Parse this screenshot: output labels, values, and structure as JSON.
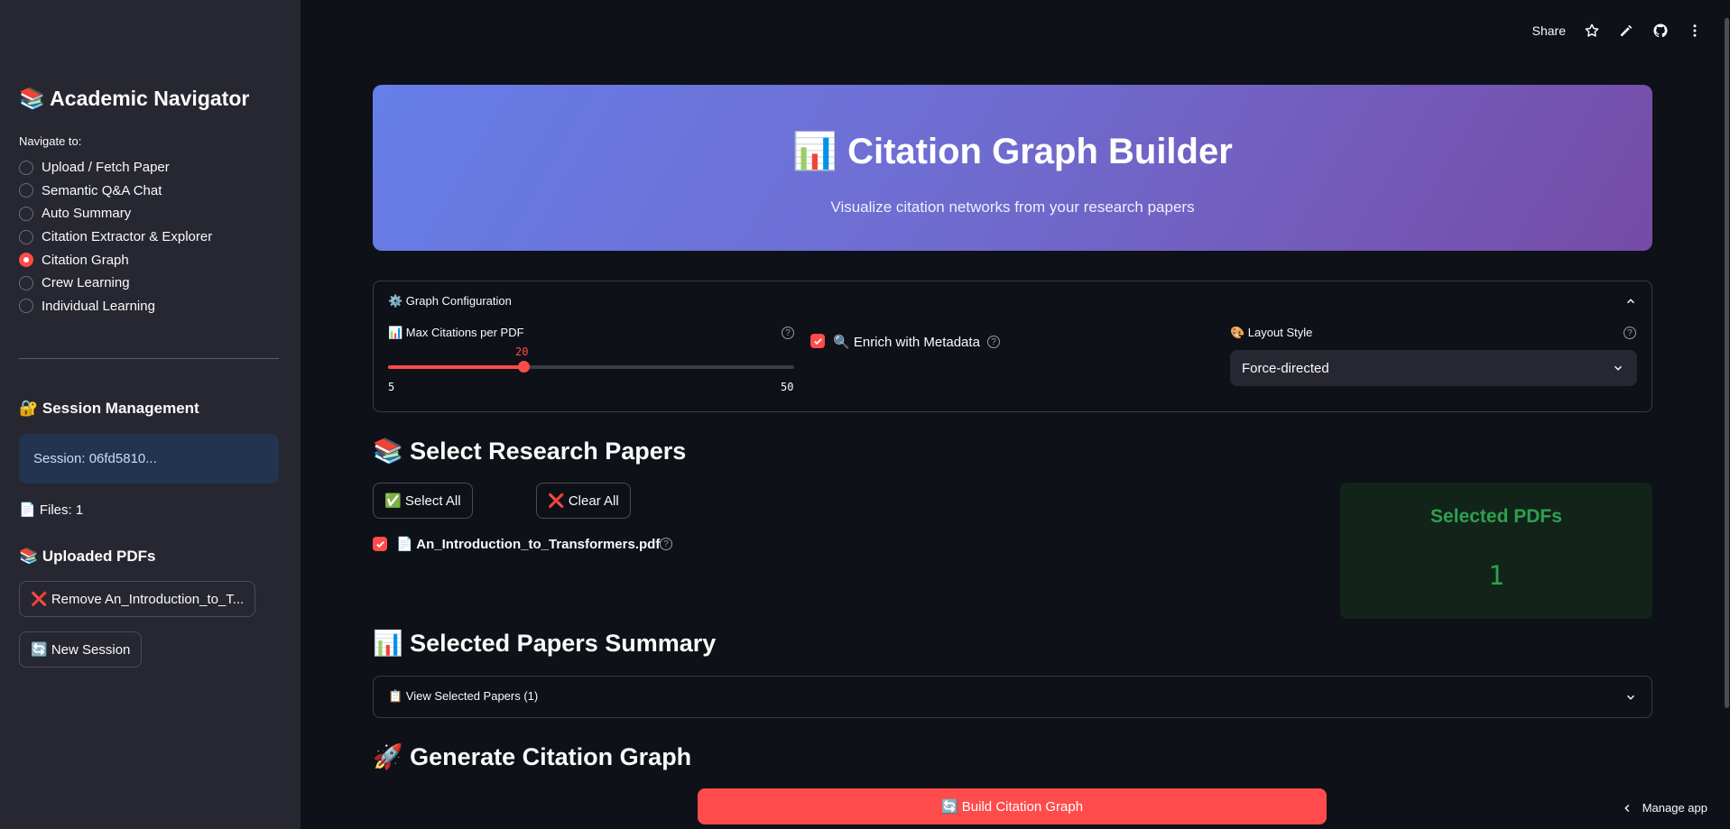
{
  "sidebar": {
    "app_title": "📚 Academic Navigator",
    "nav_label": "Navigate to:",
    "nav_items": [
      {
        "label": "Upload / Fetch Paper",
        "selected": false
      },
      {
        "label": "Semantic Q&A Chat",
        "selected": false
      },
      {
        "label": "Auto Summary",
        "selected": false
      },
      {
        "label": "Citation Extractor & Explorer",
        "selected": false
      },
      {
        "label": "Citation Graph",
        "selected": true
      },
      {
        "label": "Crew Learning",
        "selected": false
      },
      {
        "label": "Individual Learning",
        "selected": false
      }
    ],
    "session_heading": "🔐 Session Management",
    "session_text": "Session: 06fd5810...",
    "files_text": "📄 Files: 1",
    "uploaded_heading": "📚 Uploaded PDFs",
    "remove_button": "❌ Remove An_Introduction_to_T...",
    "new_session_button": "🔄 New Session"
  },
  "toolbar": {
    "share_label": "Share",
    "icons": [
      "star-icon",
      "edit-icon",
      "github-icon",
      "more-vertical-icon"
    ]
  },
  "hero": {
    "title": "📊 Citation Graph Builder",
    "subtitle": "Visualize citation networks from your research papers",
    "gradient": [
      "#667ee8",
      "#764ba7"
    ]
  },
  "config": {
    "header": "⚙️ Graph Configuration",
    "max_citations_label": "📊 Max Citations per PDF",
    "slider_value": "20",
    "slider_min": "5",
    "slider_max": "50",
    "enrich_label": "🔍 Enrich with Metadata",
    "enrich_checked": true,
    "layout_label": "🎨 Layout Style",
    "layout_value": "Force-directed"
  },
  "select_papers": {
    "heading": "📚 Select Research Papers",
    "select_all": "✅ Select All",
    "clear_all": "❌ Clear All",
    "papers": [
      {
        "label": "📄 An_Introduction_to_Transformers.pdf",
        "checked": true
      }
    ],
    "metric_title": "Selected PDFs",
    "metric_value": "1"
  },
  "summary": {
    "heading": "📊 Selected Papers Summary",
    "expander_label": "📋 View Selected Papers (1)"
  },
  "generate": {
    "heading": "🚀 Generate Citation Graph",
    "build_button": "🔄 Build Citation Graph"
  },
  "footer": {
    "manage_app": "Manage app"
  },
  "colors": {
    "accent": "#ff4b4b",
    "success": "#2ea04f",
    "background": "#0e1117",
    "sidebar": "#262730"
  }
}
